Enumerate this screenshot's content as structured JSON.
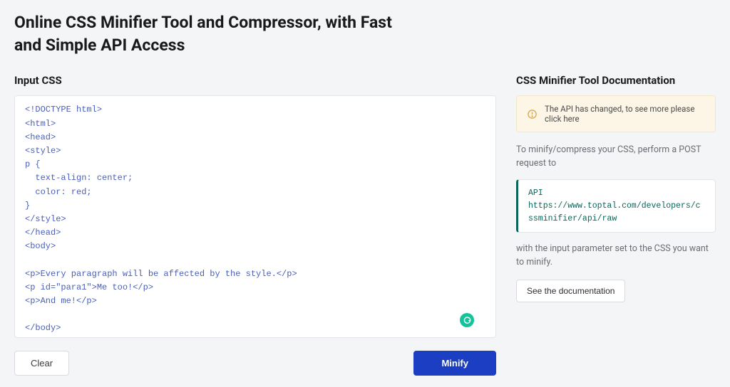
{
  "page_title": "Online CSS Minifier Tool and Compressor, with Fast and Simple API Access",
  "left": {
    "heading": "Input CSS",
    "textarea_value": "<!DOCTYPE html>\n<html>\n<head>\n<style>\np {\n  text-align: center;\n  color: red;\n}\n</style>\n</head>\n<body>\n\n<p>Every paragraph will be affected by the style.</p>\n<p id=\"para1\">Me too!</p>\n<p>And me!</p>\n\n</body>\n</html>",
    "clear_label": "Clear",
    "minify_label": "Minify"
  },
  "right": {
    "heading": "CSS Minifier Tool Documentation",
    "alert_text": "The API has changed, to see more please click here",
    "intro_text": "To minify/compress your CSS, perform a POST request to",
    "api_label": "API",
    "api_url": "https://www.toptal.com/developers/cssminifier/api/raw",
    "followup_text": "with the input parameter set to the CSS you want to minify.",
    "docs_button_label": "See the documentation"
  }
}
